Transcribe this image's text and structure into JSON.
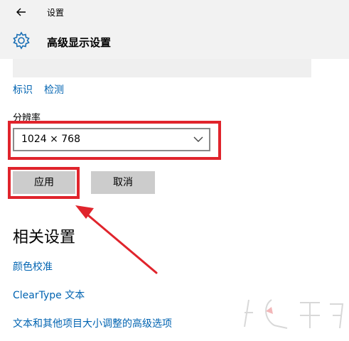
{
  "window": {
    "title": "设置"
  },
  "header": {
    "title": "高级显示设置"
  },
  "links": [
    {
      "label": "标识"
    },
    {
      "label": "检测"
    }
  ],
  "resolution": {
    "label": "分辨率",
    "selected": "1024 × 768"
  },
  "buttons": {
    "apply": "应用",
    "cancel": "取消"
  },
  "related": {
    "heading": "相关设置",
    "items": [
      {
        "label": "颜色校准"
      },
      {
        "label": "ClearType 文本"
      },
      {
        "label": "文本和其他项目大小调整的高级选项"
      }
    ]
  },
  "icons": {
    "back": "back-arrow-icon",
    "settings": "gear-icon",
    "dropdown": "chevron-down-icon"
  },
  "colors": {
    "link": "#0063b1",
    "highlight": "#e0242c",
    "button": "#cccccc",
    "header_bg": "#f2f2f2"
  }
}
